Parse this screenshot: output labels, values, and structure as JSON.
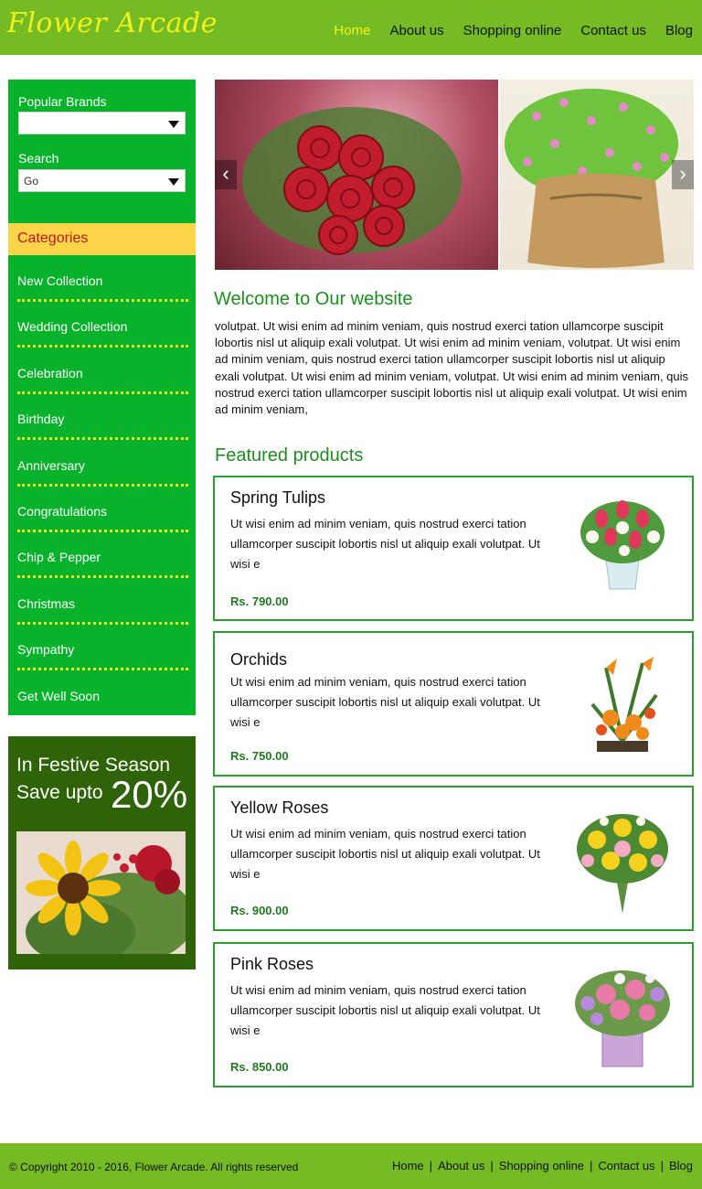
{
  "header": {
    "logo": "Flower Arcade",
    "nav": [
      "Home",
      "About us",
      "Shopping online",
      "Contact us",
      "Blog"
    ],
    "active_nav": "Home"
  },
  "sidebar": {
    "brands_label": "Popular Brands",
    "brands_value": "",
    "search_label": "Search",
    "search_value": "Go",
    "categories_title": "Categories",
    "categories": [
      "New Collection",
      "Wedding Collection",
      "Celebration",
      "Birthday",
      "Anniversary",
      "Congratulations",
      "Chip & Pepper",
      "Christmas",
      "Sympathy",
      "Get Well Soon"
    ]
  },
  "promo": {
    "line1": "In Festive Season",
    "line2": "Save upto",
    "highlight": "20%"
  },
  "slider": {
    "prev_icon": "chevron-left-icon",
    "next_icon": "chevron-right-icon"
  },
  "welcome": {
    "title": "Welcome to Our website",
    "text": "volutpat. Ut wisi enim ad minim veniam, quis nostrud exerci tation ullamcorpe suscipit lobortis nisl ut aliquip exali volutpat. Ut wisi enim ad minim veniam, volutpat. Ut wisi enim ad minim veniam, quis nostrud exerci tation ullamcorper suscipit lobortis nisl ut aliquip exali volutpat. Ut wisi enim ad minim veniam, volutpat. Ut wisi enim ad minim veniam, quis nostrud exerci tation ullamcorper suscipit lobortis nisl ut aliquip exali volutpat. Ut wisi enim ad minim veniam,"
  },
  "featured": {
    "title": "Featured products",
    "products": [
      {
        "name": "Spring Tulips",
        "desc": "Ut wisi enim ad minim veniam, quis nostrud exerci tation ullamcorper suscipit lobortis nisl ut aliquip exali volutpat. Ut wisi e",
        "price": "Rs. 790.00"
      },
      {
        "name": "Orchids",
        "desc": "Ut wisi enim ad minim veniam, quis nostrud exerci tation ullamcorper suscipit lobortis nisl ut aliquip exali volutpat. Ut wisi e",
        "price": "Rs. 750.00"
      },
      {
        "name": "Yellow Roses",
        "desc": "Ut wisi enim ad minim veniam, quis nostrud exerci tation ullamcorper suscipit lobortis nisl ut aliquip exali volutpat. Ut wisi e",
        "price": "Rs. 900.00"
      },
      {
        "name": "Pink Roses",
        "desc": "Ut wisi enim ad minim veniam, quis nostrud exerci tation ullamcorper suscipit lobortis nisl ut aliquip exali volutpat. Ut wisi e",
        "price": "Rs. 850.00"
      }
    ]
  },
  "footer": {
    "copyright": "© Copyright 2010 - 2016, Flower Arcade. All rights reserved",
    "nav": [
      "Home",
      "About us",
      "Shopping online",
      "Contact us",
      "Blog"
    ],
    "separator": "|"
  },
  "colors": {
    "header_green": "#74bb24",
    "sidebar_green": "#09b22b",
    "category_header": "#fbd448",
    "promo_green": "#2f6308",
    "accent_yellow": "#f0f219",
    "title_green": "#1b8f1b"
  }
}
